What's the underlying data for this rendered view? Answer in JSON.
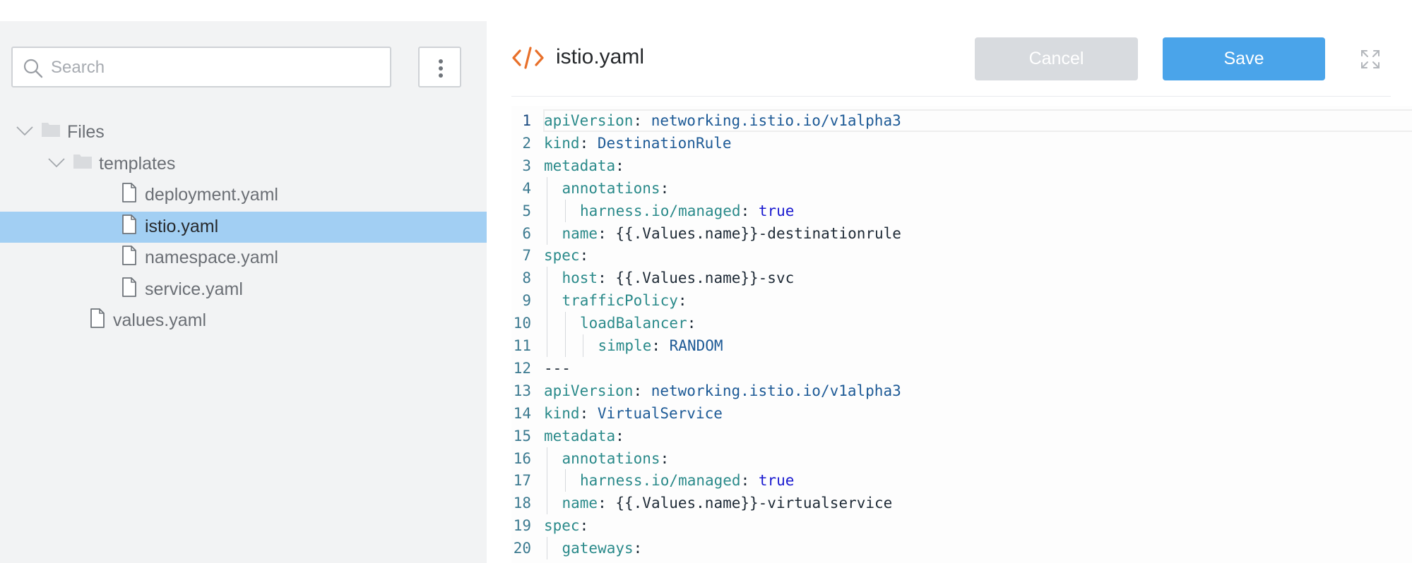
{
  "sidebar": {
    "search_placeholder": "Search",
    "tree": [
      {
        "label": "Files",
        "type": "folder",
        "expanded": true,
        "depth": 0,
        "selected": false
      },
      {
        "label": "templates",
        "type": "folder",
        "expanded": true,
        "depth": 1,
        "selected": false
      },
      {
        "label": "deployment.yaml",
        "type": "file",
        "depth": 2,
        "selected": false
      },
      {
        "label": "istio.yaml",
        "type": "file",
        "depth": 2,
        "selected": true
      },
      {
        "label": "namespace.yaml",
        "type": "file",
        "depth": 2,
        "selected": false
      },
      {
        "label": "service.yaml",
        "type": "file",
        "depth": 2,
        "selected": false
      },
      {
        "label": "values.yaml",
        "type": "file",
        "depth": 1,
        "selected": false
      }
    ]
  },
  "editor": {
    "filename": "istio.yaml",
    "cancel_label": "Cancel",
    "save_label": "Save",
    "active_line": 1,
    "lines": [
      {
        "n": "1",
        "indent": 0,
        "key": "apiVersion",
        "val": "networking.istio.io/v1alpha3",
        "vt": "str"
      },
      {
        "n": "2",
        "indent": 0,
        "key": "kind",
        "val": "DestinationRule",
        "vt": "str"
      },
      {
        "n": "3",
        "indent": 0,
        "key": "metadata",
        "val": "",
        "vt": ""
      },
      {
        "n": "4",
        "indent": 1,
        "key": "annotations",
        "val": "",
        "vt": ""
      },
      {
        "n": "5",
        "indent": 2,
        "key": "harness.io/managed",
        "val": "true",
        "vt": "bool"
      },
      {
        "n": "6",
        "indent": 1,
        "key": "name",
        "val": "{{.Values.name}}-destinationrule",
        "vt": "tmpl"
      },
      {
        "n": "7",
        "indent": 0,
        "key": "spec",
        "val": "",
        "vt": ""
      },
      {
        "n": "8",
        "indent": 1,
        "key": "host",
        "val": "{{.Values.name}}-svc",
        "vt": "tmpl"
      },
      {
        "n": "9",
        "indent": 1,
        "key": "trafficPolicy",
        "val": "",
        "vt": ""
      },
      {
        "n": "10",
        "indent": 2,
        "key": "loadBalancer",
        "val": "",
        "vt": ""
      },
      {
        "n": "11",
        "indent": 3,
        "key": "simple",
        "val": "RANDOM",
        "vt": "str"
      },
      {
        "n": "12",
        "indent": 0,
        "key": "",
        "val": "---",
        "vt": "doc"
      },
      {
        "n": "13",
        "indent": 0,
        "key": "apiVersion",
        "val": "networking.istio.io/v1alpha3",
        "vt": "str"
      },
      {
        "n": "14",
        "indent": 0,
        "key": "kind",
        "val": "VirtualService",
        "vt": "str"
      },
      {
        "n": "15",
        "indent": 0,
        "key": "metadata",
        "val": "",
        "vt": ""
      },
      {
        "n": "16",
        "indent": 1,
        "key": "annotations",
        "val": "",
        "vt": ""
      },
      {
        "n": "17",
        "indent": 2,
        "key": "harness.io/managed",
        "val": "true",
        "vt": "bool"
      },
      {
        "n": "18",
        "indent": 1,
        "key": "name",
        "val": "{{.Values.name}}-virtualservice",
        "vt": "tmpl"
      },
      {
        "n": "19",
        "indent": 0,
        "key": "spec",
        "val": "",
        "vt": ""
      },
      {
        "n": "20",
        "indent": 1,
        "key": "gateways",
        "val": "",
        "vt": ""
      }
    ]
  },
  "icons": {
    "search": "search-icon",
    "more": "vertical-dots-icon",
    "folder": "folder-icon",
    "file": "file-icon",
    "chevron": "chevron-down-icon",
    "code": "code-icon",
    "expand": "expand-icon"
  },
  "colors": {
    "accent_save": "#4aa4ea",
    "cancel_disabled": "#d8dbdf",
    "selected_row": "#a2cff3",
    "code_icon": "#e8702a",
    "sidebar_bg": "#f2f3f4"
  }
}
